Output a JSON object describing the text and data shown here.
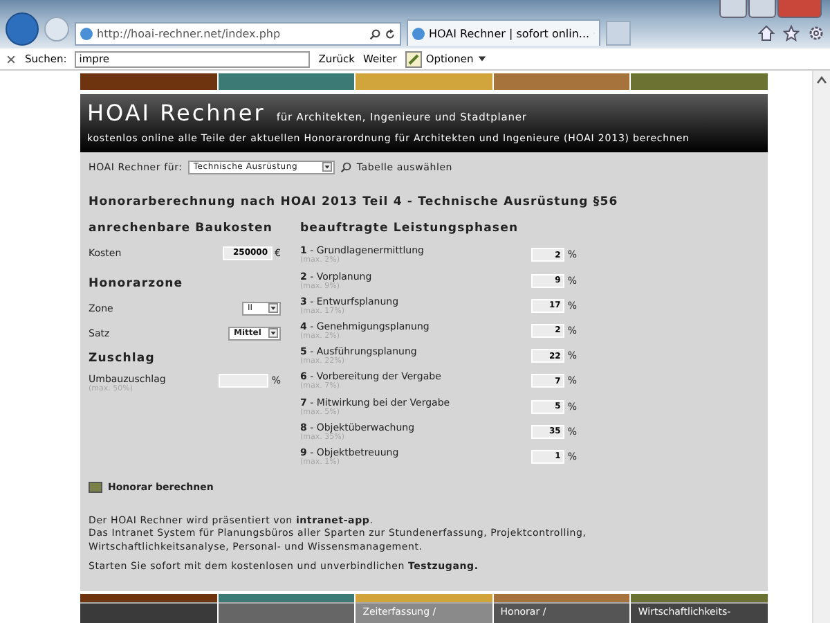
{
  "browser": {
    "address": "http://hoai-rechner.net/index.php",
    "tab_title": "HOAI Rechner | sofort onlin...",
    "find_bar": {
      "label": "Suchen:",
      "value": "impre",
      "buttons": [
        "Zurück",
        "Weiter"
      ],
      "options": "Optionen"
    }
  },
  "top_bar": [
    {
      "color": "#6e3410"
    },
    {
      "color": "#3c7a76"
    },
    {
      "color": "#d2a43c"
    },
    {
      "color": "#a6733c"
    },
    {
      "color": "#6b7232"
    }
  ],
  "header": {
    "title": "HOAI Rechner",
    "subtitle": "für Architekten, Ingenieure und Stadtplaner",
    "tagline": "kostenlos online alle Teile der aktuellen Honorarordnung für Architekten und Ingenieure (HOAI 2013) berechnen"
  },
  "selector": {
    "label": "HOAI Rechner für:",
    "value": "Technische Ausrüstung",
    "link": "Tabelle auswählen"
  },
  "heading": "Honorarberechnung nach HOAI 2013 Teil 4 - Technische Ausrüstung §56",
  "costs": {
    "heading": "anrechenbare Baukosten",
    "label": "Kosten",
    "value": "250000",
    "unit": "€"
  },
  "zone": {
    "heading": "Honorarzone",
    "fields": [
      {
        "label": "Zone",
        "value": "II",
        "kind": "narrow"
      },
      {
        "label": "Satz",
        "value": "Mittel",
        "kind": "wide"
      }
    ]
  },
  "surcharge": {
    "heading": "Zuschlag",
    "label": "Umbauzuschlag",
    "hint": "(max. 50%)",
    "unit": "%"
  },
  "phases": {
    "heading": "beauftragte Leistungsphasen",
    "items": [
      {
        "label": "**1** - Grundlagenermittlung",
        "hint": "(max. 2%)",
        "value": "2",
        "unit": "%"
      },
      {
        "label": "**2** - Vorplanung",
        "hint": "(max. 9%)",
        "value": "9",
        "unit": "%"
      },
      {
        "label": "**3** - Entwurfsplanung",
        "hint": "(max. 17%)",
        "value": "17",
        "unit": "%"
      },
      {
        "label": "**4** - Genehmigungsplanung",
        "hint": "(max. 2%)",
        "value": "2",
        "unit": "%"
      },
      {
        "label": "**5** - Ausführungsplanung",
        "hint": "(max. 22%)",
        "value": "22",
        "unit": "%"
      },
      {
        "label": "**6** - Vorbereitung der Vergabe",
        "hint": "(max. 7%)",
        "value": "7",
        "unit": "%"
      },
      {
        "label": "**7** - Mitwirkung bei der Vergabe",
        "hint": "(max. 5%)",
        "value": "5",
        "unit": "%"
      },
      {
        "label": "**8** - Objektüberwachung",
        "hint": "(max. 35%)",
        "value": "35",
        "unit": "%"
      },
      {
        "label": "**9** - Objektbetreuung",
        "hint": "(max. 1%)",
        "value": "1",
        "unit": "%"
      }
    ]
  },
  "calculate_button": "Honorar berechnen",
  "promo": [
    "Der HOAI Rechner wird präsentiert von **intranet-app**.",
    "Das Intranet System für Planungsbüros aller Sparten zur Stundenerfassung, Projektcontrolling, Wirtschaftlichkeitsanalyse, Personal- und Wissensmanagement.",
    "Starten Sie sofort mit dem kostenlosen und unverbindlichen **Testzugang.**"
  ],
  "footer_tabs": [
    {
      "color": "#6e3410"
    },
    {
      "color": "#3c7a76"
    },
    {
      "color": "#d2a43c",
      "label": "Zeiterfassung /"
    },
    {
      "color": "#a6733c",
      "label": "Honorar /"
    },
    {
      "color": "#6b7232",
      "label": "Wirtschaftlichkeits-"
    }
  ]
}
